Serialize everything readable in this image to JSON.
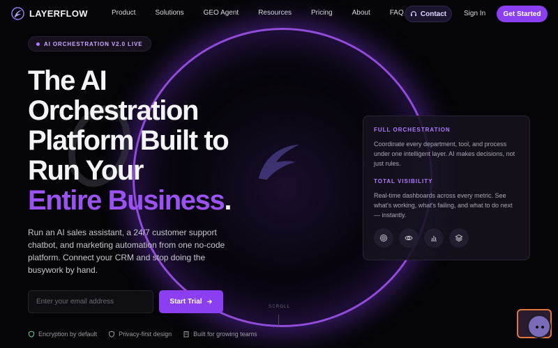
{
  "brand": {
    "name": "LAYERFLOW"
  },
  "nav": {
    "links": [
      "Product",
      "Solutions",
      "GEO Agent",
      "Resources",
      "Pricing",
      "About",
      "FAQ"
    ],
    "contact": "Contact",
    "signin": "Sign In",
    "get_started": "Get Started"
  },
  "badge": "AI ORCHESTRATION V2.0 LIVE",
  "headline": {
    "line1": "The AI",
    "line2": "Orchestration",
    "line3": "Platform Built to",
    "line4": "Run Your",
    "line5": "Entire Business",
    "period": "."
  },
  "subtext": "Run an AI sales assistant, a 24/7 customer support chatbot, and marketing automation from one no-code platform. Connect your CRM and stop doing the busywork by hand.",
  "form": {
    "email_placeholder": "Enter your email address",
    "email_value": "",
    "cta": "Start Trial"
  },
  "trust": [
    "Encryption by default",
    "Privacy-first design",
    "Built for growing teams"
  ],
  "card": {
    "h1": "FULL ORCHESTRATION",
    "p1": "Coordinate every department, tool, and process under one intelligent layer. AI makes decisions, not just rules.",
    "h2": "TOTAL VISIBILITY",
    "p2": "Real-time dashboards across every metric. See what's working, what's failing, and what to do next — instantly.",
    "icons": [
      "target-icon",
      "eye-icon",
      "chart-icon",
      "layers-icon"
    ]
  },
  "scroll_label": "SCROLL",
  "colors": {
    "accent": "#8b3ff0",
    "accent_light": "#b07aff",
    "background": "#050507"
  }
}
